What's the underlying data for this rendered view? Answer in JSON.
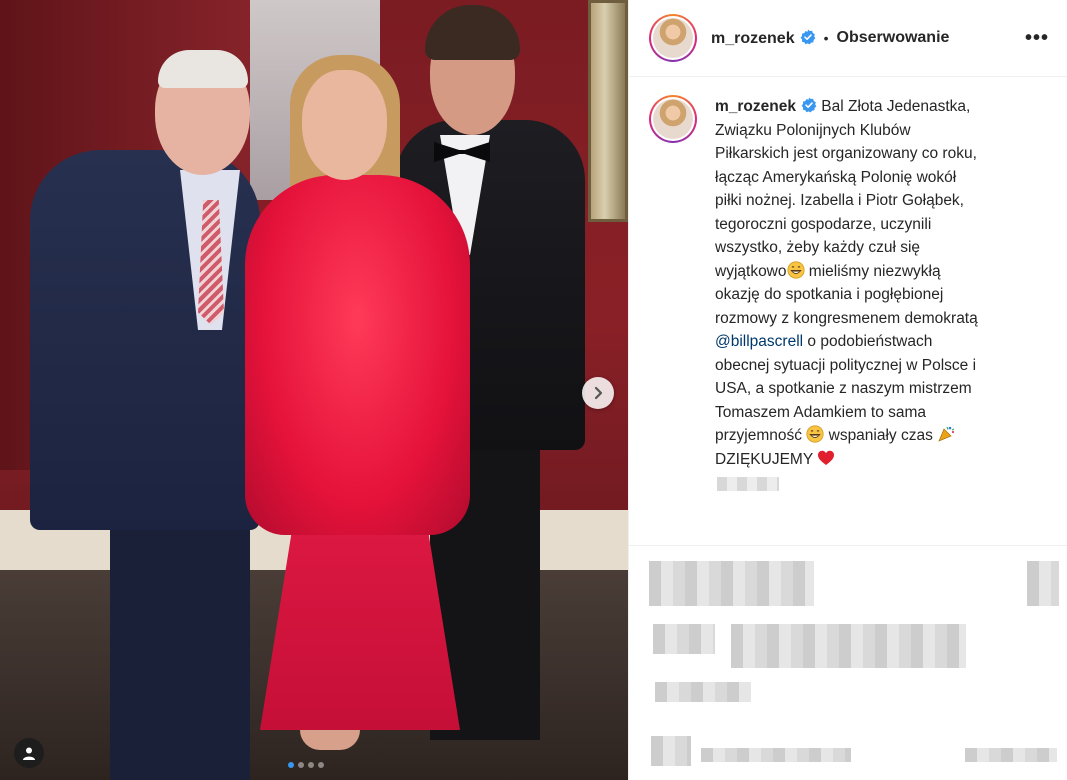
{
  "post": {
    "username": "m_rozenek",
    "follow_state": "Obserwowanie",
    "separator": "•",
    "more_label": "•••",
    "caption_username": "m_rozenek",
    "caption_lines": {
      "l1": "Bal Złota Jedenastka,",
      "l2": "Związku Polonijnych Klubów",
      "l3": "Piłkarskich jest organizowany co roku,",
      "l4": "łącząc Amerykańską Polonię wokół",
      "l5": "piłki nożnej. Izabella i Piotr Gołąbek,",
      "l6": "tegoroczni gospodarze, uczynili",
      "l7": "wszystko, żeby każdy czuł się",
      "l8a": "wyjątkowo",
      "l8b": " mieliśmy niezwykłą",
      "l9": "okazję do spotkania i pogłębionej",
      "l10": "rozmowy z kongresmenem demokratą",
      "mention": "@billpascrell",
      "l11b": " o podobieństwach",
      "l12": "obecnej sytuacji politycznej w Polsce i",
      "l13": "USA, a spotkanie z naszym mistrzem",
      "l14": "Tomaszem Adamkiem to sama",
      "l15a": "przyjemność",
      "l15b": " wspaniały czas",
      "l16": "DZIĘKUJEMY"
    }
  },
  "carousel": {
    "dots": 4,
    "active_index": 0
  },
  "icons": {
    "verified": "verified-badge-icon",
    "next": "chevron-right-icon",
    "tag": "user-tag-icon",
    "grin": "grinning-emoji-icon",
    "party": "party-popper-emoji-icon",
    "heart": "red-heart-emoji-icon"
  },
  "colors": {
    "verified_blue": "#3897f0",
    "mention": "#00376b",
    "text": "#262626",
    "dress_red": "#e5123a"
  }
}
